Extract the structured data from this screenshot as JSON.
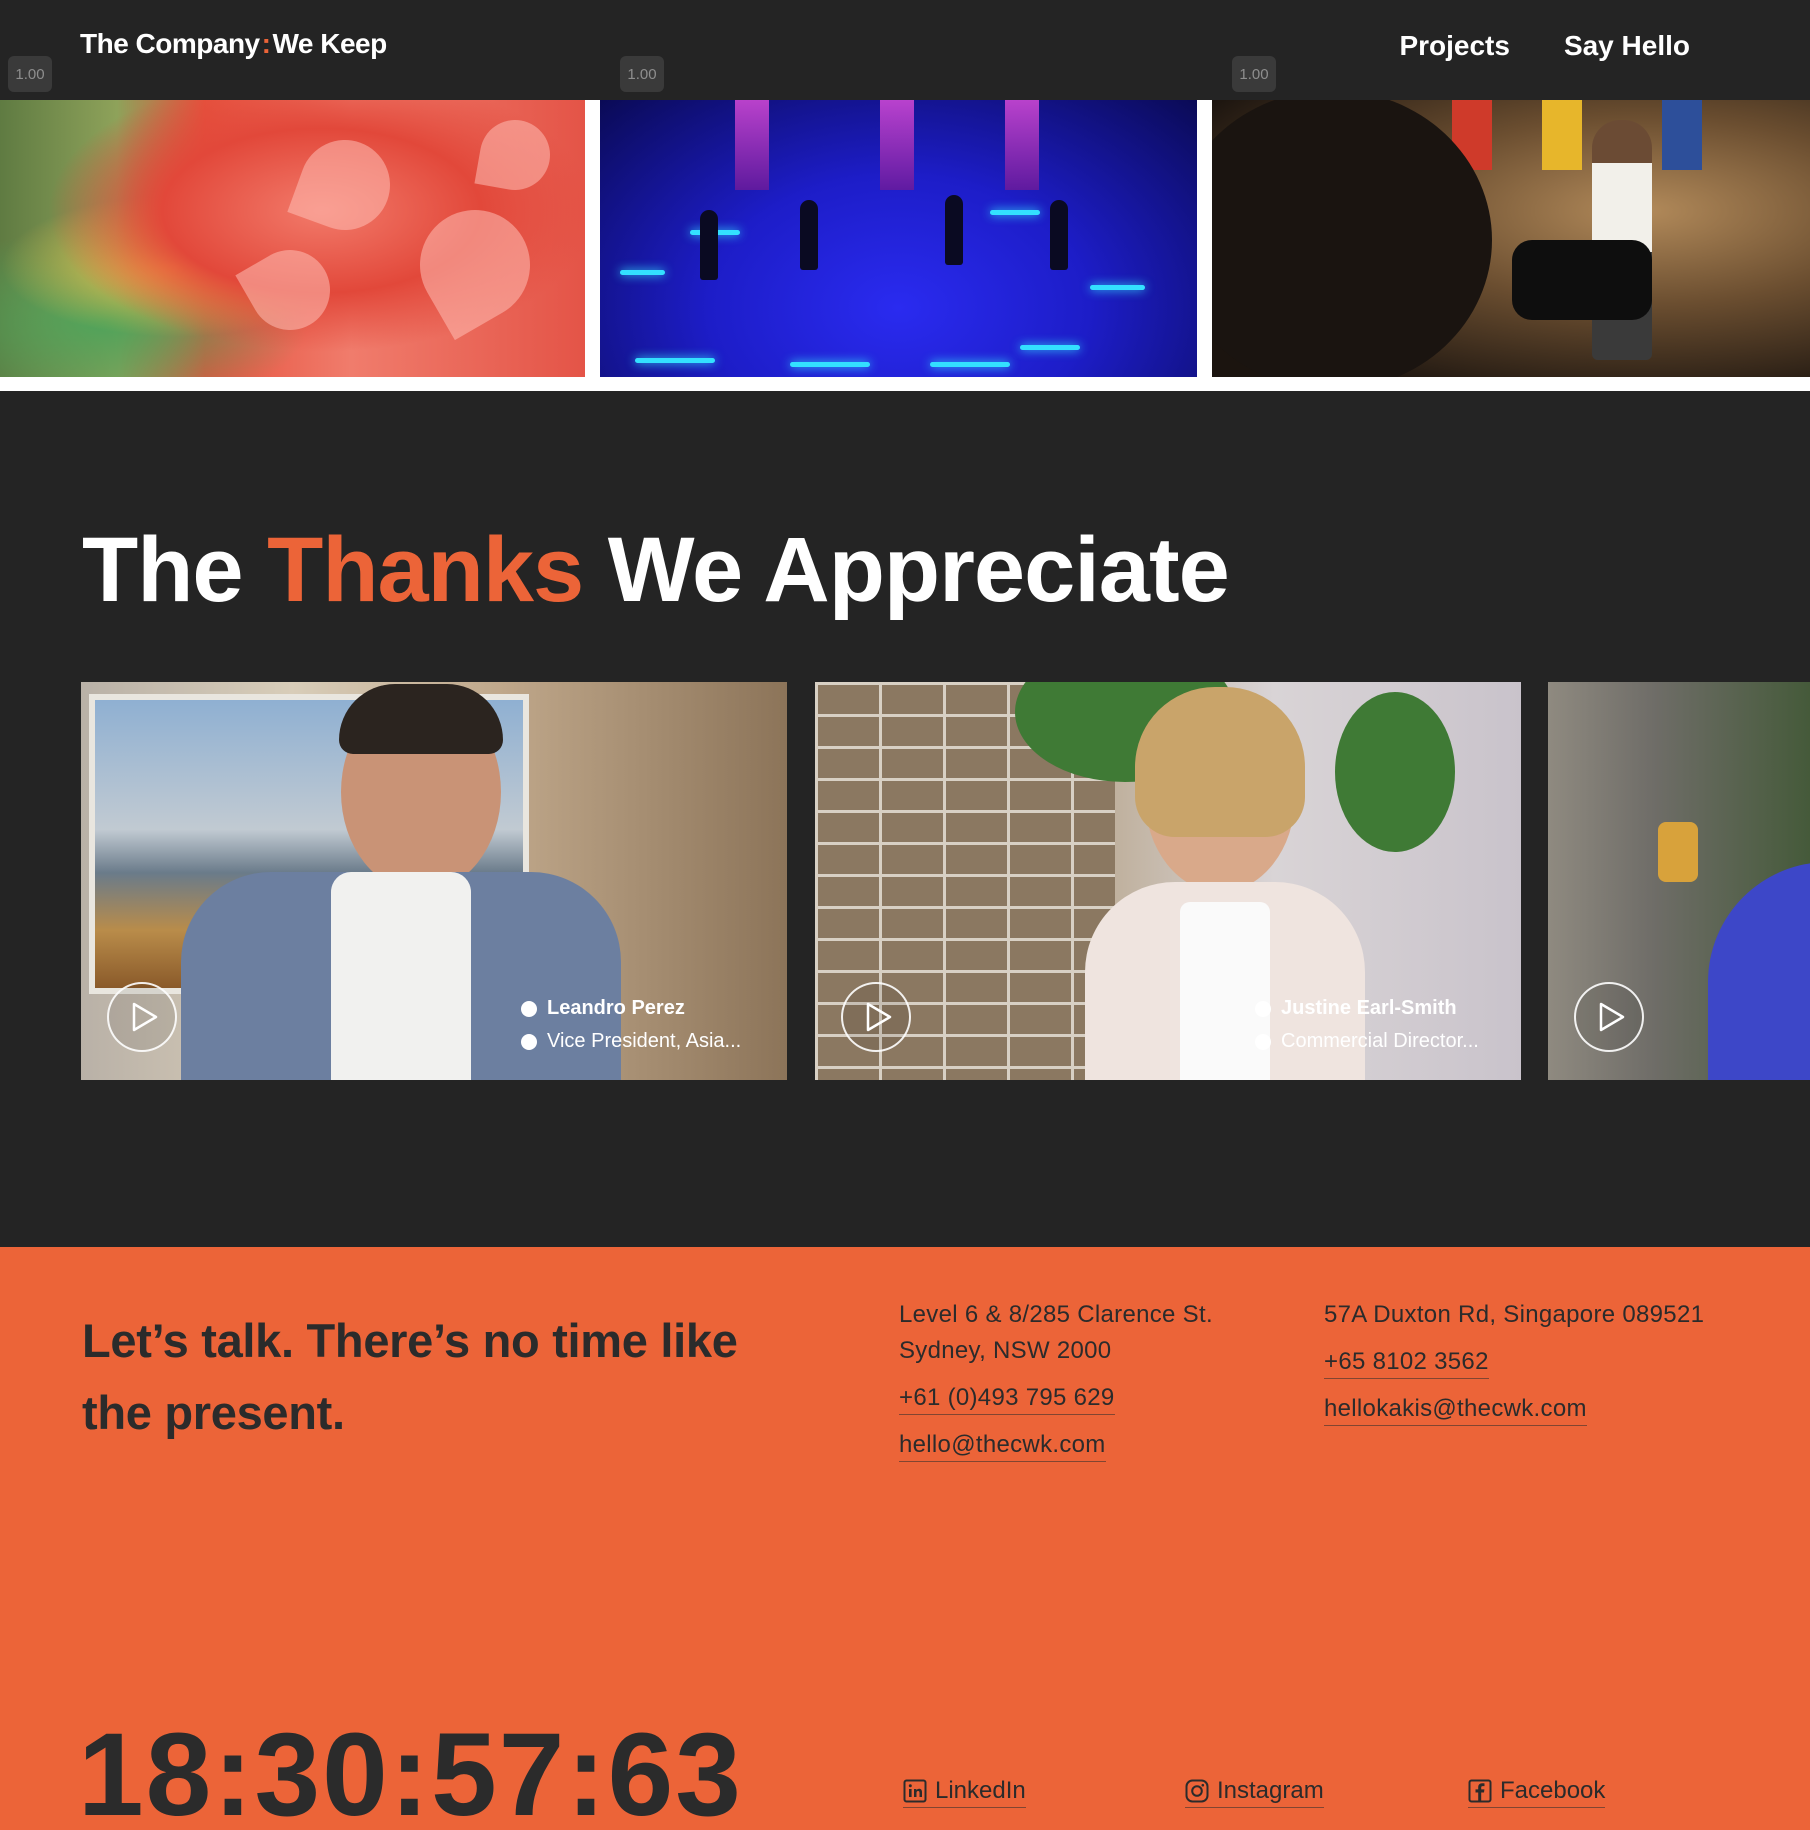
{
  "header": {
    "logo_left": "The Company",
    "logo_sep": ":",
    "logo_right": "We Keep",
    "nav": [
      {
        "label": "Projects"
      },
      {
        "label": "Say Hello"
      }
    ]
  },
  "project_tiles": [
    {
      "speed": "1.00"
    },
    {
      "speed": "1.00"
    },
    {
      "speed": "1.00"
    }
  ],
  "thanks": {
    "heading_pre": "The",
    "heading_accent": "Thanks",
    "heading_post": "We Appreciate"
  },
  "testimonials": [
    {
      "name": "Leandro Perez",
      "role": "Vice President, Asia..."
    },
    {
      "name": "Justine Earl-Smith",
      "role": "Commercial Director..."
    },
    {
      "name": "",
      "role": ""
    }
  ],
  "contact": {
    "tagline": "Let’s talk. There’s no time like the present.",
    "sydney": {
      "address_line1": "Level 6 & 8/285 Clarence St.",
      "address_line2": "Sydney, NSW 2000",
      "phone": "+61 (0)493 795 629",
      "email": "hello@thecwk.com"
    },
    "singapore": {
      "address": "57A Duxton Rd, Singapore 089521",
      "phone": "+65 8102 3562",
      "email": "hellokakis@thecwk.com"
    },
    "clock": "18:30:57:63",
    "socials": [
      {
        "label": "LinkedIn",
        "icon": "linkedin-icon"
      },
      {
        "label": "Instagram",
        "icon": "instagram-icon"
      },
      {
        "label": "Facebook",
        "icon": "facebook-icon"
      }
    ]
  },
  "colors": {
    "accent": "#ec6438",
    "dark": "#242424",
    "text_dark": "#2b2b2b"
  }
}
